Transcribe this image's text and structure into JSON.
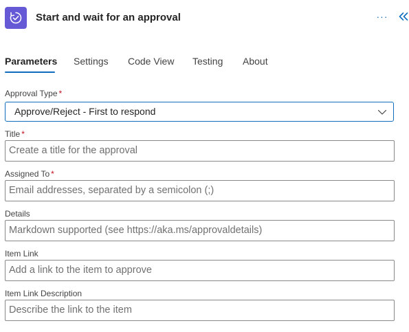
{
  "header": {
    "title": "Start and wait for an approval",
    "app_icon": "approval-icon",
    "more_label": "···",
    "collapse_icon": "double-chevron-left-icon",
    "accent_color": "#6659d6",
    "link_color": "#0f6cbd"
  },
  "tabs": [
    {
      "label": "Parameters",
      "active": true
    },
    {
      "label": "Settings",
      "active": false
    },
    {
      "label": "Code View",
      "active": false
    },
    {
      "label": "Testing",
      "active": false
    },
    {
      "label": "About",
      "active": false
    }
  ],
  "form": {
    "approval_type": {
      "label": "Approval Type",
      "required_mark": "*",
      "value": "Approve/Reject - First to respond"
    },
    "title": {
      "label": "Title",
      "required_mark": "*",
      "placeholder": "Create a title for the approval"
    },
    "assigned_to": {
      "label": "Assigned To",
      "required_mark": "*",
      "placeholder": "Email addresses, separated by a semicolon (;)"
    },
    "details": {
      "label": "Details",
      "placeholder": "Markdown supported (see https://aka.ms/approvaldetails)"
    },
    "item_link": {
      "label": "Item Link",
      "placeholder": "Add a link to the item to approve"
    },
    "item_link_description": {
      "label": "Item Link Description",
      "placeholder": "Describe the link to the item"
    }
  }
}
